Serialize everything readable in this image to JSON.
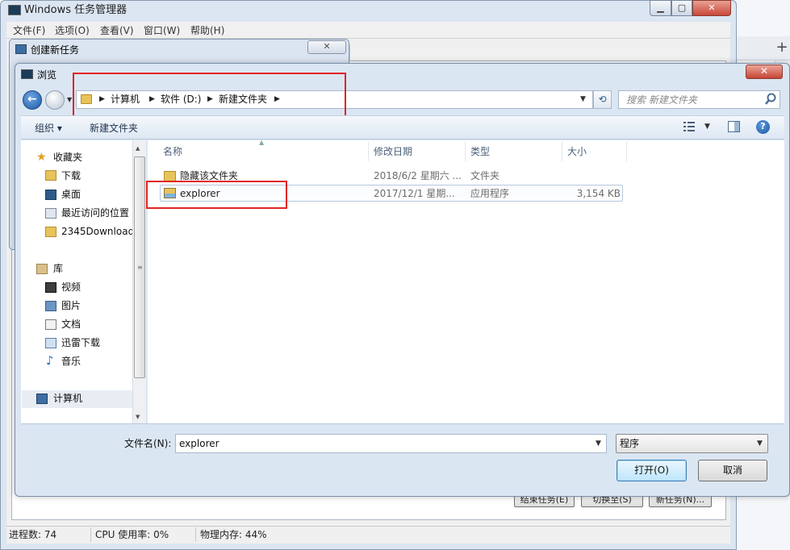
{
  "task_manager": {
    "title": "Windows 任务管理器",
    "menu": [
      "文件(F)",
      "选项(O)",
      "查看(V)",
      "窗口(W)",
      "帮助(H)"
    ],
    "buttons": [
      "结束任务(E)",
      "切换至(S)",
      "新任务(N)..."
    ],
    "status": {
      "processes": "进程数: 74",
      "cpu": "CPU 使用率: 0%",
      "memory": "物理内存: 44%"
    }
  },
  "create_task_dialog": {
    "title": "创建新任务"
  },
  "browse_dialog": {
    "title": "浏览",
    "breadcrumbs": [
      "计算机",
      "软件 (D:)",
      "新建文件夹"
    ],
    "search_placeholder": "搜索 新建文件夹",
    "toolbar": {
      "organize": "组织 ▾",
      "new_folder": "新建文件夹"
    },
    "nav_pane": {
      "favorites_header": "收藏夹",
      "favorites": [
        "下载",
        "桌面",
        "最近访问的位置",
        "2345Downloads"
      ],
      "libraries_header": "库",
      "libraries": [
        "视频",
        "图片",
        "文档",
        "迅雷下载",
        "音乐"
      ],
      "computer": "计算机"
    },
    "columns": [
      "名称",
      "修改日期",
      "类型",
      "大小"
    ],
    "files": [
      {
        "name": "隐藏该文件夹",
        "date": "2018/6/2 星期六 ...",
        "type": "文件夹",
        "size": ""
      },
      {
        "name": "explorer",
        "date": "2017/12/1 星期...",
        "type": "应用程序",
        "size": "3,154 KB"
      }
    ],
    "filename_label": "文件名(N):",
    "filename_value": "explorer",
    "filetype_value": "程序",
    "open_button": "打开(O)",
    "cancel_button": "取消"
  },
  "colors": {
    "annotation_red": "#e02424",
    "dialog_frame": "#dbe6f3",
    "close_red": "#c54637"
  }
}
